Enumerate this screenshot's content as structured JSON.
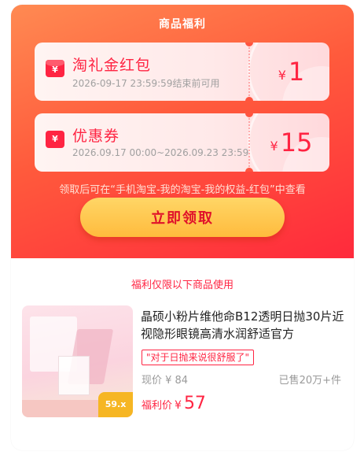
{
  "header": {
    "title": "商品福利"
  },
  "coupons": [
    {
      "icon": "red-envelope-icon",
      "icon_glyph": "¥",
      "name": "淘礼金红包",
      "validity": "2026-09-17 23:59:59结束前可用",
      "currency": "¥",
      "amount": "1"
    },
    {
      "icon": "coupon-ticket-icon",
      "icon_glyph": "¥",
      "name": "优惠券",
      "validity": "2026.09.17 00:00~2026.09.23 23:59",
      "currency": "¥",
      "amount": "15"
    }
  ],
  "hint": "领取后可在“手机淘宝-我的淘宝-我的权益-红包”中查看",
  "claim_button": "立即领取",
  "scope_text": "福利仅限以下商品使用",
  "product": {
    "title": "晶硕小粉片维他命B12透明日抛30片近视隐形眼镜高清水润舒适官方",
    "review_tag": "\"对于日抛来说很舒服了\"",
    "current_price": "现价 ¥ 84",
    "sold": "已售20万+件",
    "welfare_label": "福利价",
    "welfare_currency": "¥",
    "welfare_price": "57",
    "image_badge": "59.x"
  },
  "colors": {
    "accent": "#ff2442",
    "header_gradient_start": "#ff8a52",
    "header_gradient_end": "#ff2a3c",
    "button_yellow": "#ffc94d"
  }
}
